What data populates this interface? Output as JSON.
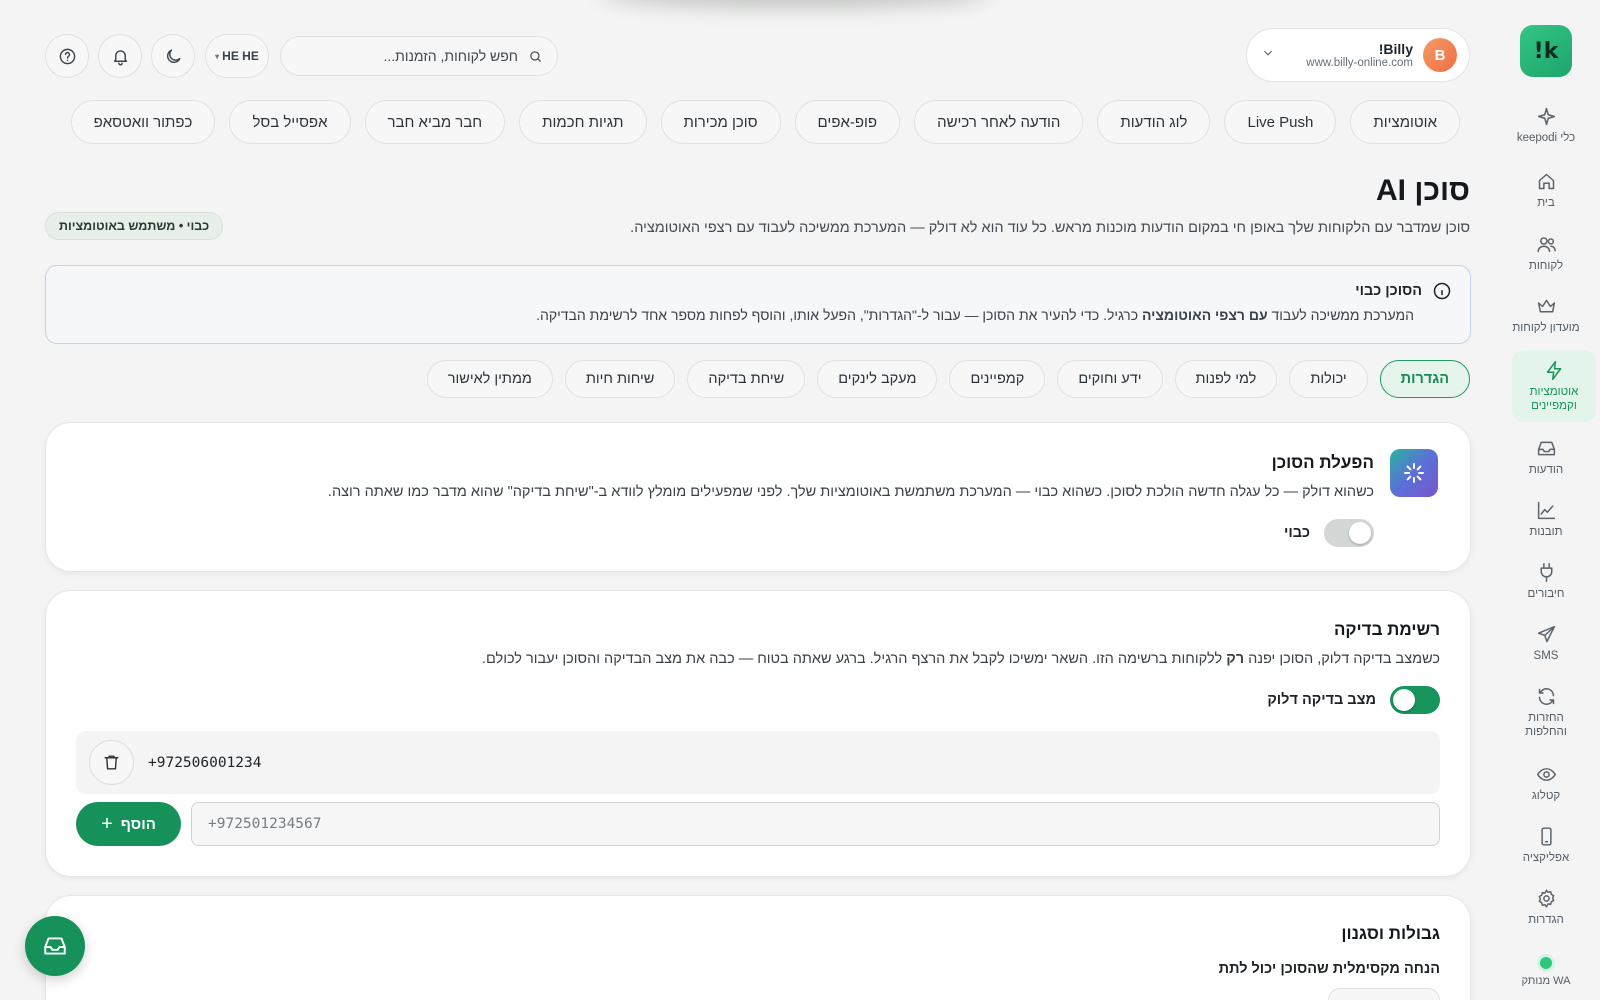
{
  "sidebar": {
    "logo": "!k",
    "items": [
      {
        "label": "כלי keepodi",
        "icon": "sparkle-icon"
      },
      {
        "label": "בית",
        "icon": "home-icon"
      },
      {
        "label": "לקוחות",
        "icon": "users-icon"
      },
      {
        "label": "מועדון לקוחות",
        "icon": "crown-icon"
      },
      {
        "label": "אוטומציות וקמפיינים",
        "icon": "bolt-icon",
        "active": true
      },
      {
        "label": "הודעות",
        "icon": "inbox-icon"
      },
      {
        "label": "תובנות",
        "icon": "chart-icon"
      },
      {
        "label": "חיבורים",
        "icon": "plug-icon"
      },
      {
        "label": "SMS",
        "icon": "send-icon"
      },
      {
        "label": "החזרות והחלפות",
        "icon": "refresh-icon"
      },
      {
        "label": "קטלוג",
        "icon": "eye-icon"
      },
      {
        "label": "אפליקציה",
        "icon": "phone-icon"
      },
      {
        "label": "הגדרות",
        "icon": "gear-icon"
      },
      {
        "label": "WA מנותק",
        "icon": "status-dot-icon"
      }
    ]
  },
  "header": {
    "brand_name": "Billy!",
    "brand_url": "www.billy-online.com",
    "avatar_letter": "B",
    "search_placeholder": "חפש לקוחות, הזמנות...",
    "lang_label": "HE HE"
  },
  "chips": [
    "אוטומציות",
    "Live Push",
    "לוג הודעות",
    "הודעה לאחר רכישה",
    "פופ-אפים",
    "סוכן מכירות",
    "תגיות חכמות",
    "חבר מביא חבר",
    "אפסייל בסל",
    "כפתור וואטסאפ"
  ],
  "page": {
    "title": "סוכן AI",
    "subtitle": "סוכן שמדבר עם הלקוחות שלך באופן חי במקום הודעות מוכנות מראש. כל עוד הוא לא דולק — המערכת ממשיכה לעבוד עם רצפי האוטומציה.",
    "status_pill": "כבוי • משתמש באוטומציות"
  },
  "notice": {
    "title": "הסוכן כבוי",
    "text_before": "המערכת ממשיכה לעבוד ",
    "text_bold": "עם רצפי האוטומציה",
    "text_after": " כרגיל. כדי להעיר את הסוכן — עבור ל-\"הגדרות\", הפעל אותו, והוסף לפחות מספר אחד לרשימת הבדיקה."
  },
  "tabs": [
    "הגדרות",
    "יכולות",
    "למי לפנות",
    "ידע וחוקים",
    "קמפיינים",
    "מעקב לינקים",
    "שיחת בדיקה",
    "שיחות חיות",
    "ממתין לאישור"
  ],
  "activation_card": {
    "title": "הפעלת הסוכן",
    "desc": "כשהוא דולק — כל עגלה חדשה הולכת לסוכן. כשהוא כבוי — המערכת משתמשת באוטומציות שלך. לפני שמפעילים מומלץ לוודא ב-\"שיחת בדיקה\" שהוא מדבר כמו שאתה רוצה.",
    "toggle_label": "כבוי",
    "toggle_on": false
  },
  "testlist_card": {
    "title": "רשימת בדיקה",
    "desc_before": "כשמצב בדיקה דלוק, הסוכן יפנה ",
    "desc_bold": "רק",
    "desc_after": " ללקוחות ברשימה הזו. השאר ימשיכו לקבל את הרצף הרגיל. ברגע שאתה בטוח — כבה את מצב הבדיקה והסוכן יעבור לכולם.",
    "toggle_label": "מצב בדיקה דלוק",
    "toggle_on": true,
    "numbers": [
      "+972506001234"
    ],
    "input_placeholder": "+972501234567",
    "add_label": "הוסף"
  },
  "limits_card": {
    "title": "גבולות וסגנון",
    "max_discount_label": "הנחה מקסימלית שהסוכן יכול לתת"
  },
  "colors": {
    "accent": "#16915a",
    "active_bg": "#e3f4ea",
    "notice_border": "#c8cff0"
  }
}
